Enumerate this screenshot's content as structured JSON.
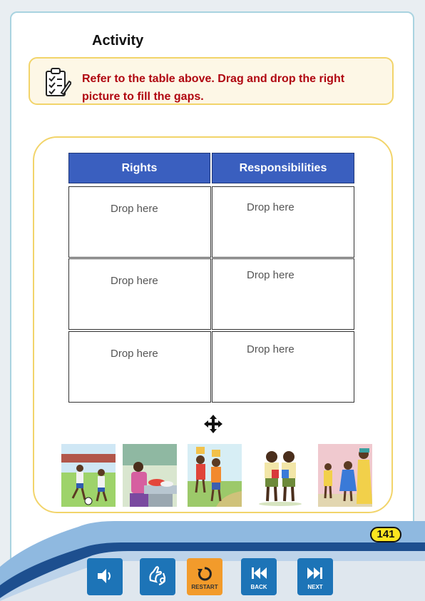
{
  "activity": {
    "title": "Activity",
    "instruction": "Refer to the table above. Drag and drop the right picture to fill the gaps."
  },
  "table": {
    "headers": [
      "Rights",
      "Responsibilities"
    ],
    "drop_label": "Drop here"
  },
  "pictures": [
    {
      "icon": "children-playing-football"
    },
    {
      "icon": "person-washing-dishes"
    },
    {
      "icon": "children-fetching-water"
    },
    {
      "icon": "children-holding-books"
    },
    {
      "icon": "family-greeting-at-home"
    }
  ],
  "page_number": "141",
  "nav": {
    "audio_icon": "speaker-icon",
    "sign_icon": "sign-language-icon",
    "restart_label": "RESTART",
    "back_label": "BACK",
    "next_label": "NEXT"
  },
  "colors": {
    "header_blue": "#3a5fbf",
    "instruction_red": "#b00610",
    "panel_border": "#f2d46a",
    "button_blue": "#1d74b7",
    "restart_orange": "#f29b2b",
    "page_badge": "#fce51f"
  }
}
